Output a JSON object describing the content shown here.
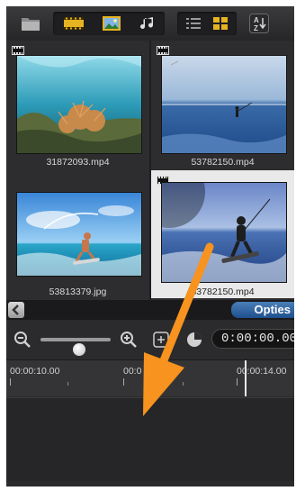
{
  "toolbar": {
    "icons": [
      "folder-icon",
      "film-filter-icon",
      "photo-filter-icon",
      "music-filter-icon",
      "list-view-icon",
      "grid-view-icon",
      "sort-az-icon"
    ]
  },
  "library": {
    "items": [
      {
        "filename": "31872093.mp4",
        "type": "video",
        "selected": false
      },
      {
        "filename": "53782150.mp4",
        "type": "video",
        "selected": false
      },
      {
        "filename": "53813379.jpg",
        "type": "photo",
        "selected": false
      },
      {
        "filename": "53782150.mp4",
        "type": "video",
        "selected": true
      }
    ]
  },
  "options_bar": {
    "options_label": "Opties",
    "back_icon": "chevron-left-icon"
  },
  "timeline": {
    "timecode": "0:00:00.00",
    "ruler_labels": [
      "00:00:10.00",
      "00:0",
      "00",
      "00:00:14.00"
    ],
    "zoom_slider_value": 0.6
  },
  "annotation": {
    "arrow_color": "#f7931e"
  }
}
